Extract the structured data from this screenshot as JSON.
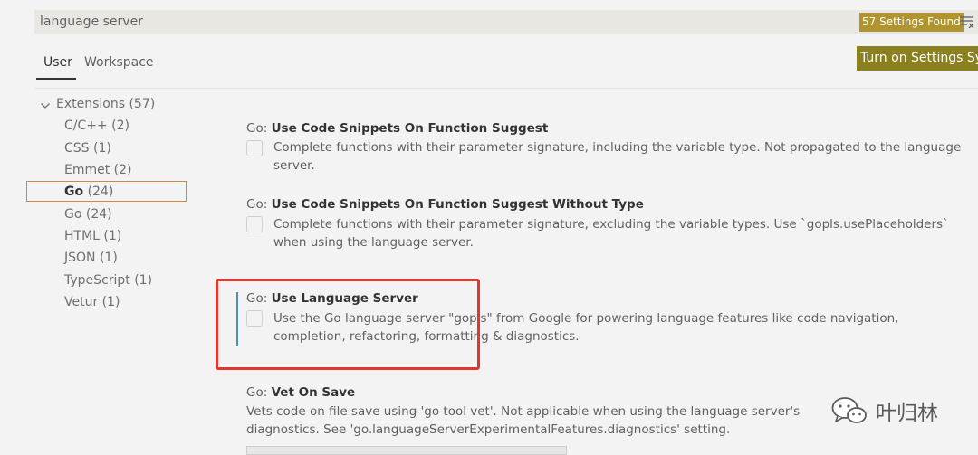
{
  "search": {
    "value": "language server",
    "results_count": "57 Settings Found"
  },
  "tabs": [
    {
      "label": "User"
    },
    {
      "label": "Workspace"
    }
  ],
  "sync_button_label": "Turn on Settings Sync",
  "toc": {
    "extensions": "Extensions (57)",
    "items": [
      {
        "label": "C/C++ (2)"
      },
      {
        "label": "CSS (1)"
      },
      {
        "label": "Emmet (2)"
      },
      {
        "name": "Go",
        "count": "(24)"
      },
      {
        "label": "Go (24)"
      },
      {
        "label": "HTML (1)"
      },
      {
        "label": "JSON (1)"
      },
      {
        "label": "TypeScript (1)"
      },
      {
        "label": "Vetur (1)"
      }
    ]
  },
  "settings": [
    {
      "category": "Go:",
      "name": "Use Code Snippets On Function Suggest",
      "description": "Complete functions with their parameter signature, including the variable type. Not propagated to the language server."
    },
    {
      "category": "Go:",
      "name": "Use Code Snippets On Function Suggest Without Type",
      "description": "Complete functions with their parameter signature, excluding the variable types. Use `gopls.usePlaceholders` when using the language server."
    },
    {
      "category": "Go:",
      "name": "Use Language Server",
      "description": "Use the Go language server \"gopls\" from Google for powering language features like code navigation, completion, refactoring, formatting & diagnostics."
    },
    {
      "category": "Go:",
      "name": "Vet On Save",
      "description": "Vets code on file save using 'go tool vet'. Not applicable when using the language server's diagnostics. See 'go.languageServerExperimentalFeatures.diagnostics' setting."
    }
  ],
  "watermark": {
    "text": "叶归林"
  },
  "colors": {
    "badge": "#b0952f",
    "sync_button": "#8a8020",
    "selection_border": "#d08a3c",
    "highlight": "#e23731",
    "focus_indicator": "#4f8cc9"
  },
  "icons": {
    "filter": "filter-icon",
    "chevron": "chevron-down-icon",
    "watermark": "wechat-icon"
  }
}
